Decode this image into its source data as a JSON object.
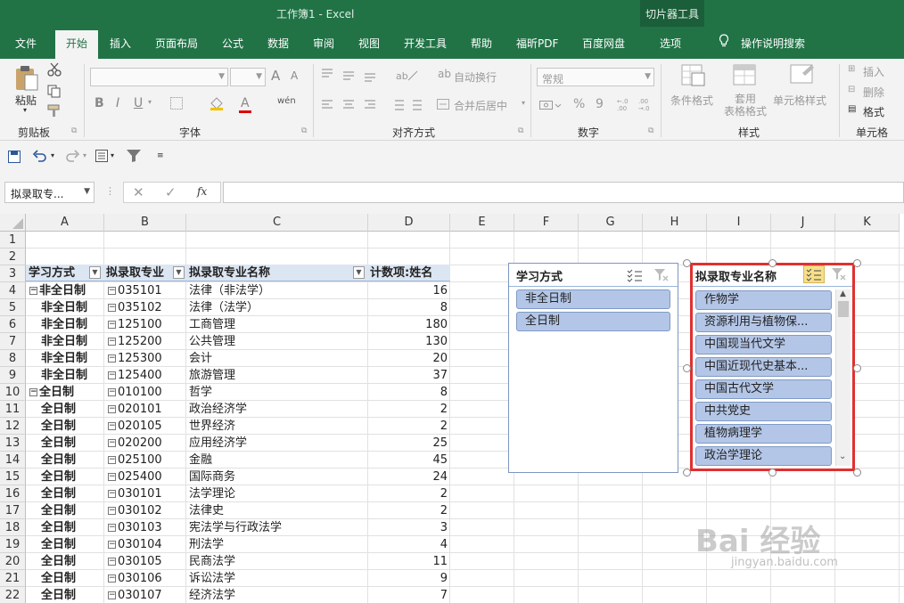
{
  "window": {
    "title": "工作簿1  -  Excel",
    "context_tab_group": "切片器工具"
  },
  "tabs": [
    "文件",
    "开始",
    "插入",
    "页面布局",
    "公式",
    "数据",
    "审阅",
    "视图",
    "开发工具",
    "帮助",
    "福昕PDF",
    "百度网盘",
    "选项"
  ],
  "active_tab": "开始",
  "tell_me": "操作说明搜索",
  "ribbon": {
    "clipboard": {
      "label": "剪贴板",
      "paste": "粘贴"
    },
    "font": {
      "label": "字体",
      "size_up": "A",
      "size_down": "A",
      "bold": "B",
      "italic": "I",
      "underline": "U",
      "phonetic": "wén"
    },
    "alignment": {
      "label": "对齐方式",
      "wrap": "自动换行",
      "merge": "合并后居中"
    },
    "number": {
      "label": "数字",
      "format": "常规",
      "percent": "%",
      "comma": "9",
      "inc": "←.0 .00",
      "dec": ".00 →.0"
    },
    "styles": {
      "label": "样式",
      "cond": "条件格式",
      "table": "套用\n表格格式",
      "cell_styles": "单元格样式"
    },
    "cells": {
      "label": "单元格",
      "insert": "插入",
      "delete": "删除",
      "format": "格式"
    }
  },
  "name_box": "拟录取专...",
  "fx": "fx",
  "columns": [
    "A",
    "B",
    "C",
    "D",
    "E",
    "F",
    "G",
    "H",
    "I",
    "J",
    "K"
  ],
  "rows": [
    "1",
    "2",
    "3",
    "4",
    "5",
    "6",
    "7",
    "8",
    "9",
    "10",
    "11",
    "12",
    "13",
    "14",
    "15",
    "16",
    "17",
    "18",
    "19",
    "20",
    "21",
    "22"
  ],
  "pivot": {
    "headers": [
      "学习方式",
      "拟录取专业",
      "拟录取专业名称",
      "计数项:姓名"
    ],
    "data": [
      [
        "非全日制",
        "035101",
        "法律（非法学）",
        "16",
        true
      ],
      [
        "非全日制",
        "035102",
        "法律（法学）",
        "8",
        false
      ],
      [
        "非全日制",
        "125100",
        "工商管理",
        "180",
        false
      ],
      [
        "非全日制",
        "125200",
        "公共管理",
        "130",
        false
      ],
      [
        "非全日制",
        "125300",
        "会计",
        "20",
        false
      ],
      [
        "非全日制",
        "125400",
        "旅游管理",
        "37",
        false
      ],
      [
        "全日制",
        "010100",
        "哲学",
        "8",
        true
      ],
      [
        "全日制",
        "020101",
        "政治经济学",
        "2",
        false
      ],
      [
        "全日制",
        "020105",
        "世界经济",
        "2",
        false
      ],
      [
        "全日制",
        "020200",
        "应用经济学",
        "25",
        false
      ],
      [
        "全日制",
        "025100",
        "金融",
        "45",
        false
      ],
      [
        "全日制",
        "025400",
        "国际商务",
        "24",
        false
      ],
      [
        "全日制",
        "030101",
        "法学理论",
        "2",
        false
      ],
      [
        "全日制",
        "030102",
        "法律史",
        "2",
        false
      ],
      [
        "全日制",
        "030103",
        "宪法学与行政法学",
        "3",
        false
      ],
      [
        "全日制",
        "030104",
        "刑法学",
        "4",
        false
      ],
      [
        "全日制",
        "030105",
        "民商法学",
        "11",
        false
      ],
      [
        "全日制",
        "030106",
        "诉讼法学",
        "9",
        false
      ],
      [
        "全日制",
        "030107",
        "经济法学",
        "7",
        false
      ]
    ]
  },
  "slicer1": {
    "title": "学习方式",
    "items": [
      "非全日制",
      "全日制"
    ]
  },
  "slicer2": {
    "title": "拟录取专业名称",
    "items": [
      "作物学",
      "资源利用与植物保...",
      "中国现当代文学",
      "中国近现代史基本...",
      "中国古代文学",
      "中共党史",
      "植物病理学",
      "政治学理论"
    ]
  },
  "colors": {
    "excel_green": "#217346",
    "slicer_item": "#b4c6e7",
    "selection_red": "#e03030"
  },
  "watermark": {
    "main": "Bai 经验",
    "sub": "jingyan.baidu.com"
  }
}
